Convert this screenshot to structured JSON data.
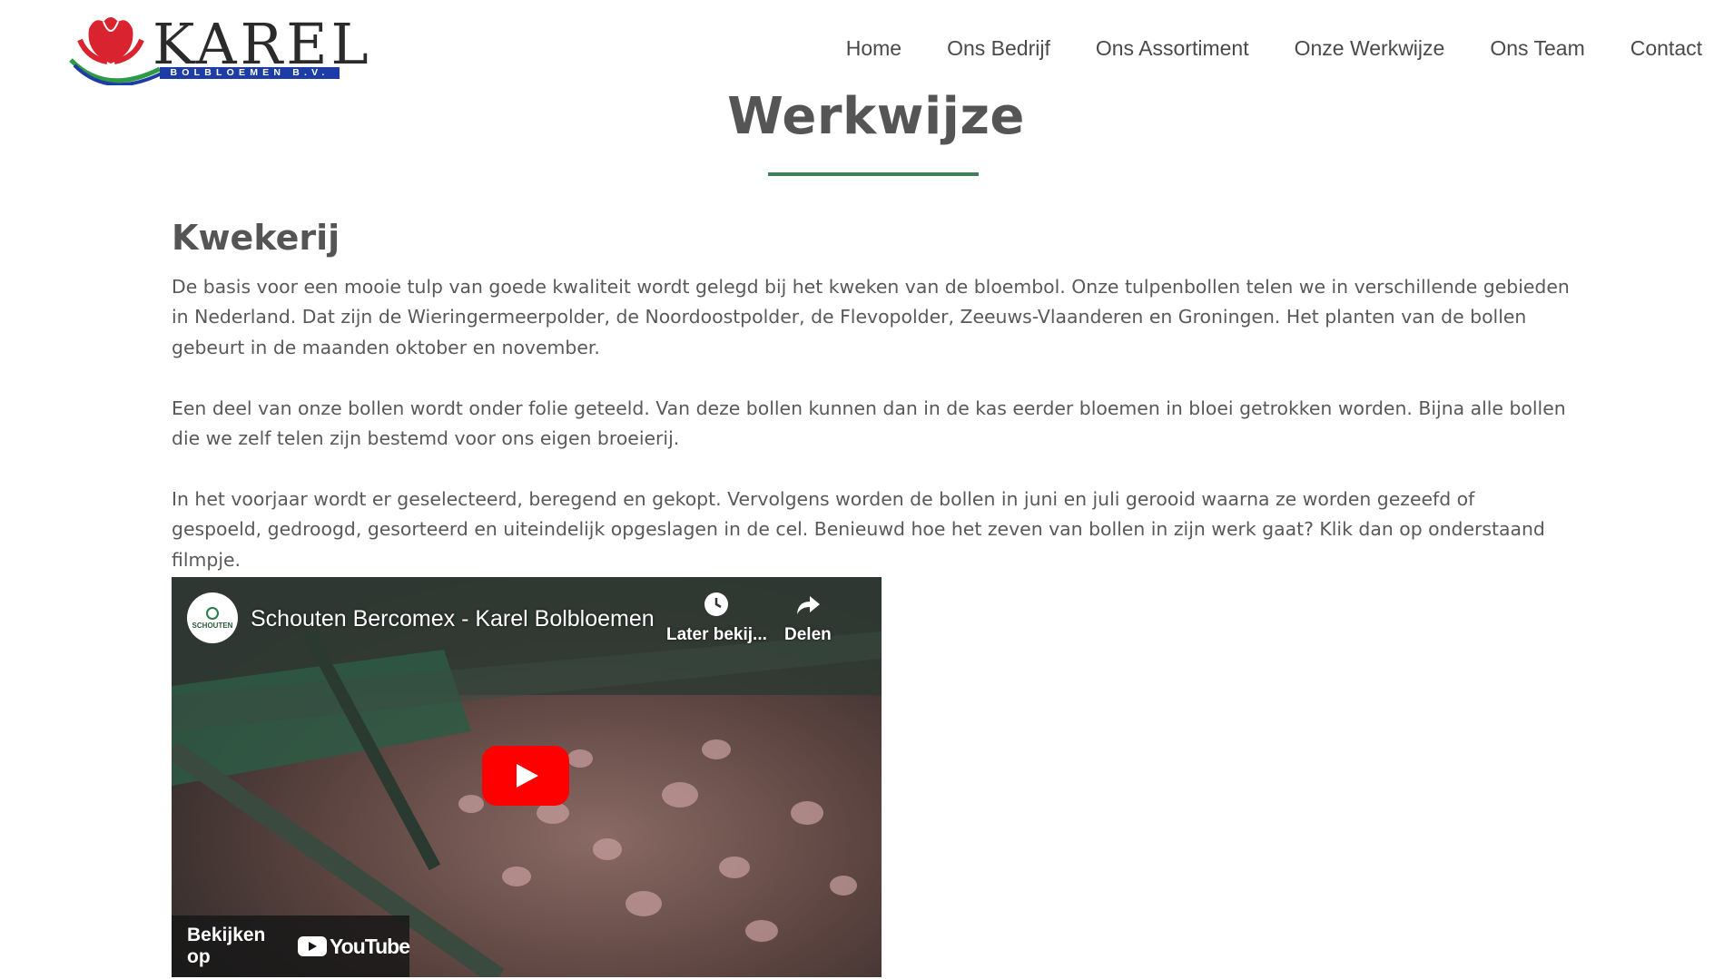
{
  "logo": {
    "wordmark": "KAREL",
    "subtitle": "BOLBLOEMEN B.V."
  },
  "nav": {
    "items": [
      {
        "label": "Home"
      },
      {
        "label": "Ons Bedrijf"
      },
      {
        "label": "Ons Assortiment"
      },
      {
        "label": "Onze Werkwijze"
      },
      {
        "label": "Ons Team"
      },
      {
        "label": "Contact"
      }
    ]
  },
  "page": {
    "title": "Werkwijze"
  },
  "section": {
    "heading": "Kwekerij",
    "paragraphs": [
      "De basis voor een mooie tulp van goede kwaliteit wordt gelegd bij het kweken van de bloembol. Onze tulpenbollen telen we in verschillende gebieden in Nederland. Dat zijn de Wieringermeerpolder, de Noordoostpolder, de Flevopolder, Zeeuws-Vlaanderen en Groningen. Het planten van de bollen gebeurt in de maanden oktober en november.",
      "Een deel van onze bollen wordt onder folie geteeld. Van deze bollen kunnen dan in de kas eerder bloemen in bloei getrokken worden. Bijna alle bollen die we zelf telen zijn bestemd voor ons eigen broeierij.",
      "In het voorjaar wordt er geselecteerd, beregend en gekopt. Vervolgens worden de bollen in juni en juli gerooid waarna ze worden gezeefd of gespoeld, gedroogd, gesorteerd en uiteindelijk opgeslagen in de cel. Benieuwd hoe het zeven van bollen in zijn werk gaat? Klik dan op onderstaand filmpje."
    ]
  },
  "video": {
    "channel_label": "SCHOUTEN",
    "title": "Schouten Bercomex - Karel Bolbloemen",
    "watch_later": "Later bekij...",
    "share": "Delen",
    "watch_on": "Bekijken op",
    "youtube": "YouTube"
  },
  "colors": {
    "accent_green": "#3f7f57",
    "logo_red": "#d9232f",
    "logo_blue": "#1d3ca6",
    "youtube_red": "#ff0000"
  }
}
